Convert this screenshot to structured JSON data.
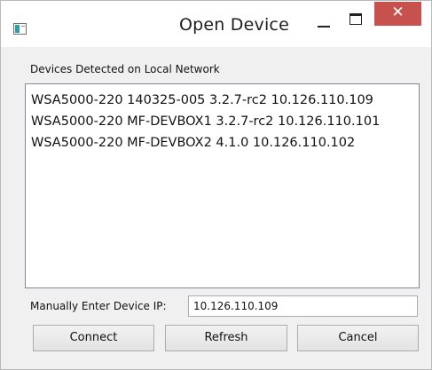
{
  "window": {
    "title": "Open Device",
    "controls": {
      "minimize_icon": "minimize-icon",
      "maximize_icon": "maximize-icon",
      "close_icon": "close-icon",
      "close_glyph": "✕",
      "close_color": "#c7514c"
    }
  },
  "devices": {
    "section_label": "Devices Detected on Local Network",
    "items": [
      "WSA5000-220 140325-005 3.2.7-rc2 10.126.110.109",
      "WSA5000-220 MF-DEVBOX1 3.2.7-rc2 10.126.110.101",
      "WSA5000-220 MF-DEVBOX2 4.1.0 10.126.110.102"
    ]
  },
  "manual_ip": {
    "label": "Manually Enter Device IP:",
    "value": "10.126.110.109"
  },
  "buttons": {
    "connect": "Connect",
    "refresh": "Refresh",
    "cancel": "Cancel"
  }
}
